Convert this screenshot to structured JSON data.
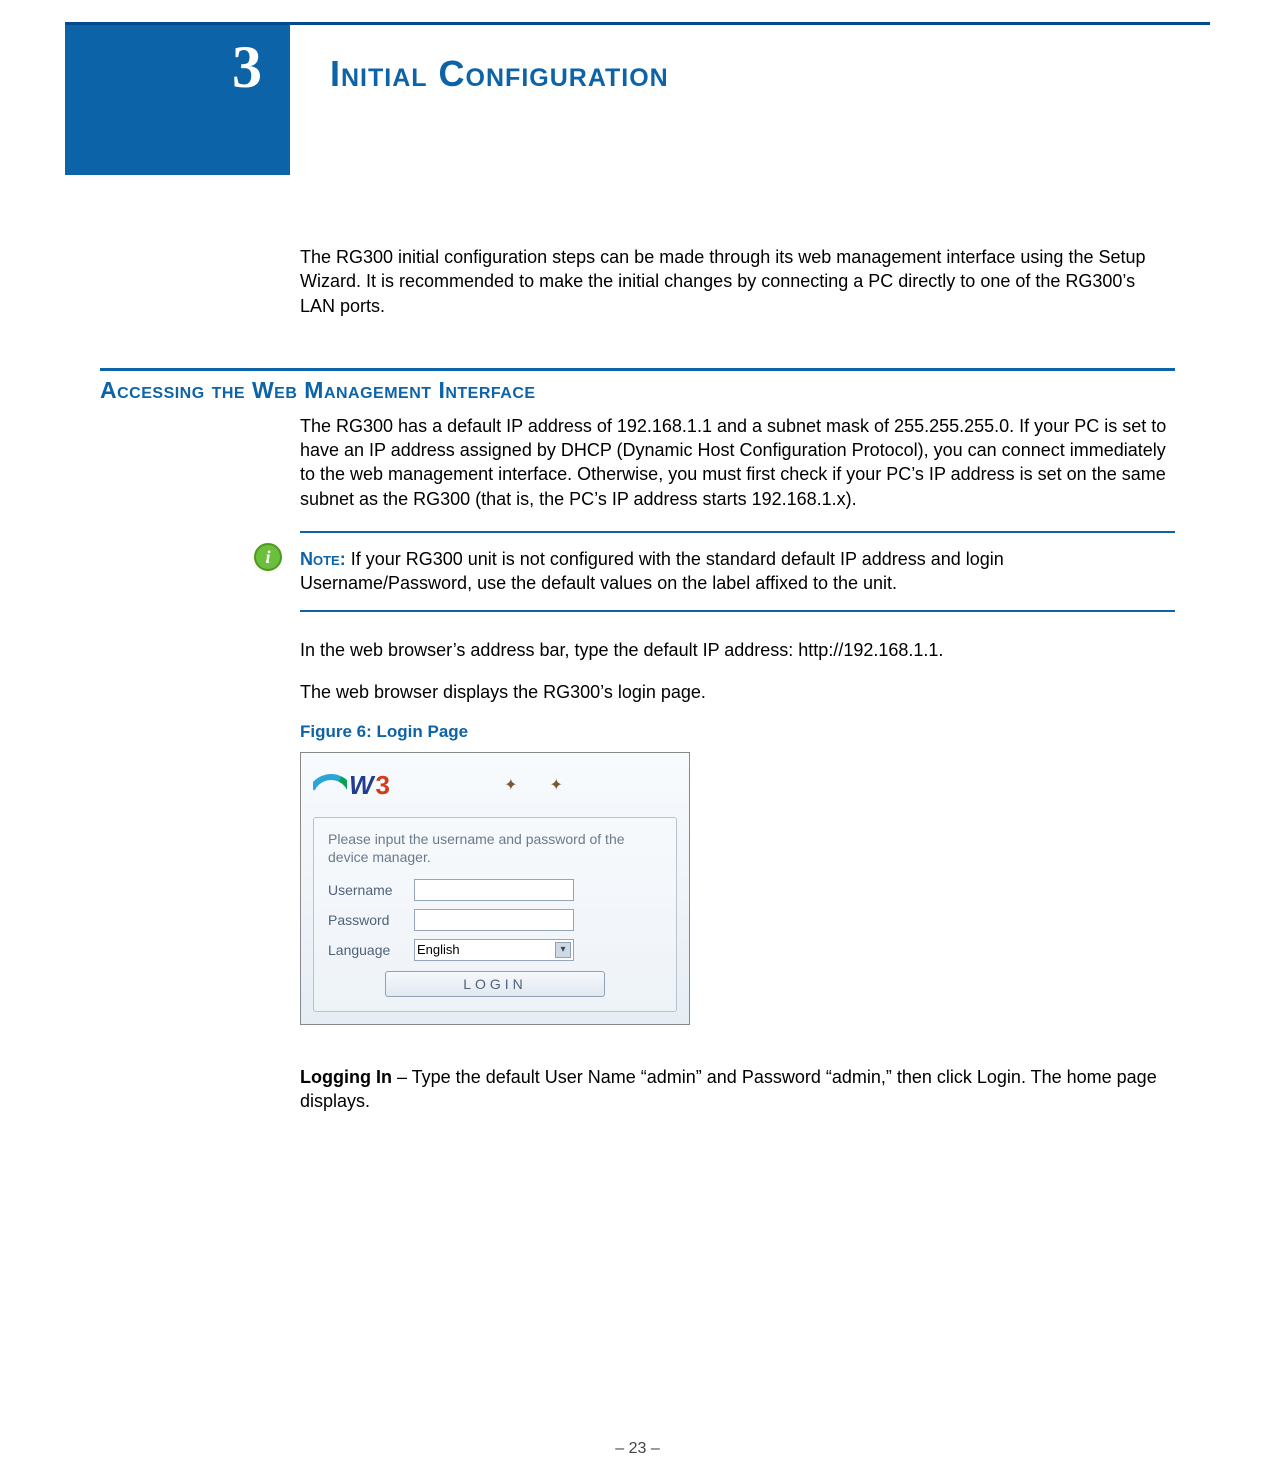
{
  "chapter": {
    "number": "3",
    "title": "Initial Configuration"
  },
  "intro_para": "The RG300 initial configuration steps can be made through its web management interface using the Setup Wizard. It is recommended to make the initial changes by connecting a PC directly to one of the RG300’s LAN ports.",
  "section_heading": "Accessing the Web Management Interface",
  "section_para": "The RG300 has a default IP address of 192.168.1.1 and a subnet mask of 255.255.255.0. If your PC is set to have an IP address assigned by DHCP (Dynamic Host Configuration Protocol), you can connect immediately to the web management interface. Otherwise, you must first check if your PC’s IP address is set on the same subnet as the RG300 (that is, the PC’s IP address starts 192.168.1.x).",
  "note": {
    "label": "Note:",
    "text": " If your RG300 unit is not configured with the standard default IP address and login Username/Password, use the default values on the label affixed to the unit."
  },
  "after_note_para_1": "In the web browser’s address bar, type the default IP address: http://192.168.1.1.",
  "after_note_para_2": "The web browser displays the RG300’s login page.",
  "figure_caption": "Figure 6:  Login Page",
  "login": {
    "prompt": "Please input the username and password of the device manager.",
    "labels": {
      "username": "Username",
      "password": "Password",
      "language": "Language"
    },
    "language_selected": "English",
    "button": "LOGIN"
  },
  "post_figure": {
    "strong": "Logging In",
    "rest": " – Type the default User Name “admin” and Password “admin,” then click Login. The home page displays."
  },
  "footer": "–  23  –",
  "icons": {
    "info": "i",
    "fly1": "⚊͘",
    "fly2": "⚋͘"
  }
}
